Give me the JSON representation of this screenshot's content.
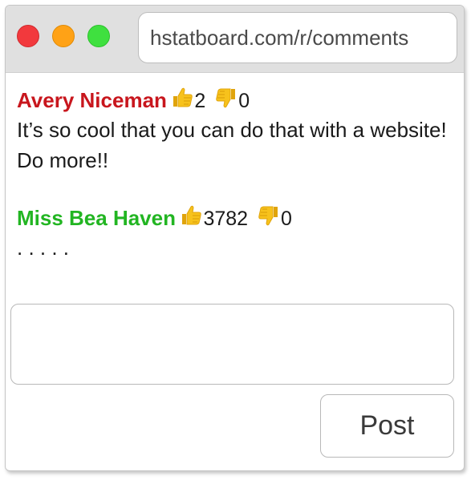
{
  "browser": {
    "url": "hstatboard.com/r/comments",
    "traffic_lights": [
      "close",
      "minimize",
      "maximize"
    ]
  },
  "comments": [
    {
      "author": "Avery Niceman",
      "author_color": "#c8161d",
      "thumbs_up": "2",
      "thumbs_down": "0",
      "text": "It’s so cool that you can do that with a website! Do more!!"
    },
    {
      "author": "Miss Bea Haven",
      "author_color": "#22b522",
      "thumbs_up": "3782",
      "thumbs_down": "0",
      "text": ". . . . ."
    }
  ],
  "composer": {
    "value": "",
    "post_label": "Post"
  },
  "icons": {
    "thumbs_up": "thumbs-up-icon",
    "thumbs_down": "thumbs-down-icon",
    "thumb_color": "#f7c21c"
  }
}
